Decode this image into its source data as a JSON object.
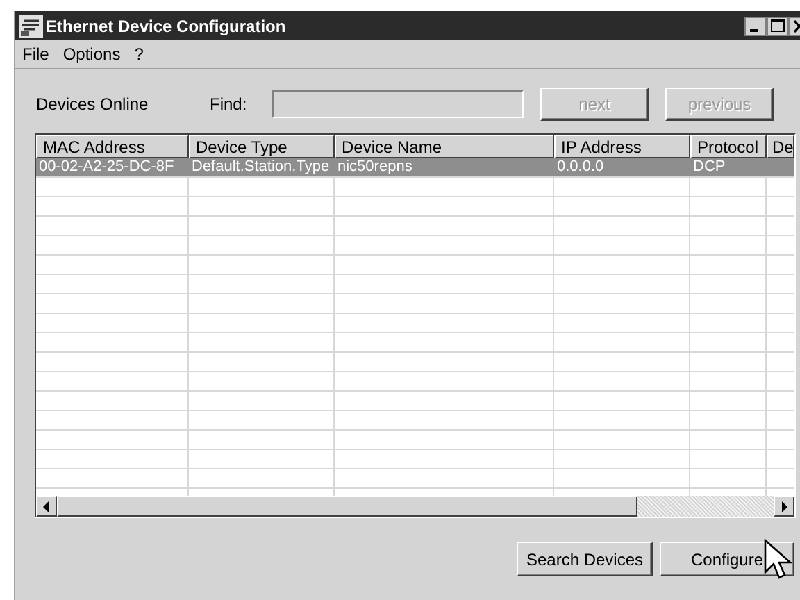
{
  "window": {
    "title": "Ethernet Device Configuration"
  },
  "menu": [
    "File",
    "Options",
    "?"
  ],
  "devices_label": "Devices Online",
  "find": {
    "label": "Find:"
  },
  "nav_buttons": [
    {
      "label": "next",
      "disabled": true
    },
    {
      "label": "previous",
      "disabled": true
    }
  ],
  "table": {
    "columns": [
      "MAC Address",
      "Device Type",
      "Device Name",
      "IP Address",
      "Protocol",
      "De"
    ],
    "rows": [
      {
        "cells": [
          "00-02-A2-25-DC-8F",
          "Default.Station.Type",
          "nic50repns",
          "0.0.0.0",
          "DCP",
          ""
        ],
        "selected": true
      }
    ]
  },
  "buttons": [
    {
      "label": "Search Devices"
    },
    {
      "label": "Configure"
    }
  ]
}
